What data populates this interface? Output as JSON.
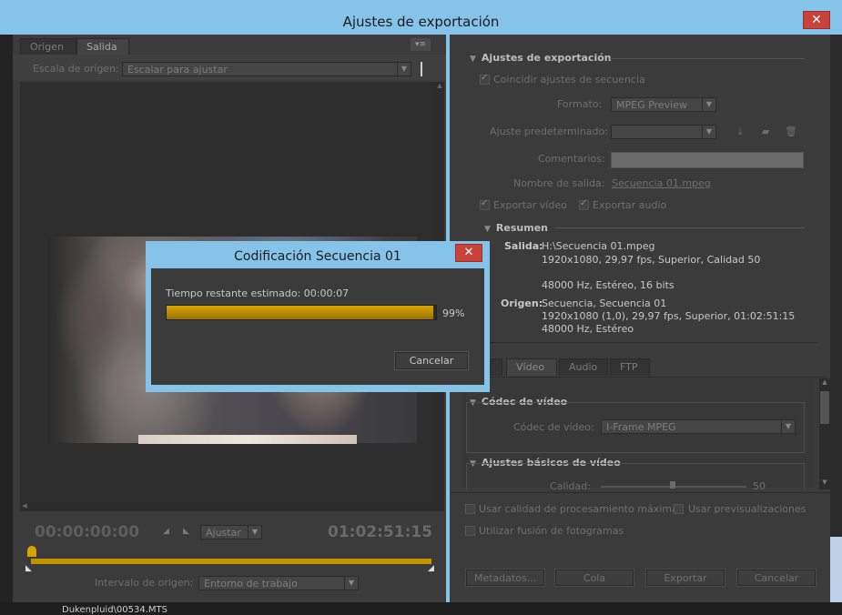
{
  "window": {
    "title": "Ajustes de exportación",
    "close_glyph": "✕"
  },
  "left": {
    "tabs": [
      "Origen",
      "Salida"
    ],
    "menu_glyph": "▾≡",
    "scale_label": "Escala de origen:",
    "scale_value": "Escalar para ajustar",
    "timecode_start": "00:00:00:00",
    "timecode_end": "01:02:51:15",
    "fit_value": "Ajustar",
    "range_label": "Intervalo de origen:",
    "range_value": "Entorno de trabajo"
  },
  "right": {
    "export_section": "Ajustes de exportación",
    "match_sequence": "Coincidir ajustes de secuencia",
    "format_label": "Formato:",
    "format_value": "MPEG Preview",
    "preset_label": "Ajuste predeterminado:",
    "preset_value": "",
    "comments_label": "Comentarios:",
    "output_name_label": "Nombre de salida:",
    "output_name_value": "Secuencia 01.mpeg",
    "export_video": "Exportar vídeo",
    "export_audio": "Exportar audio",
    "summary_section": "Resumen",
    "output_label": "Salida:",
    "output_lines": [
      "H:\\Secuencia 01.mpeg",
      "1920x1080, 29,97 fps, Superior, Calidad 50",
      "48000 Hz, Estéreo, 16 bits"
    ],
    "source_label": "Origen:",
    "source_lines": [
      "Secuencia, Secuencia 01",
      "1920x1080 (1,0), 29,97 fps, Superior, 01:02:51:15",
      "48000 Hz, Estéreo"
    ],
    "tabs": [
      "Vídeo",
      "Audio",
      "FTP"
    ],
    "codec_section": "Códec de vídeo",
    "codec_label": "Códec de vídeo:",
    "codec_value": "I-Frame MPEG",
    "basic_section": "Ajustes básicos de vídeo",
    "quality_label": "Calidad:",
    "quality_value": "50",
    "max_quality": "Usar calidad de procesamiento máxima",
    "use_previews": "Usar previsualizaciones",
    "frame_blend": "Utilizar fusión de fotogramas",
    "buttons": {
      "metadata": "Metadatos...",
      "queue": "Cola",
      "export": "Exportar",
      "cancel": "Cancelar"
    }
  },
  "dialog": {
    "title": "Codificación Secuencia 01",
    "close_glyph": "✕",
    "remaining": "Tiempo restante estimado: 00:00:07",
    "percent_text": "99%",
    "progress": 0.99,
    "cancel": "Cancelar"
  },
  "background": {
    "file_text": "Dukenpluid\\00534.MTS"
  }
}
